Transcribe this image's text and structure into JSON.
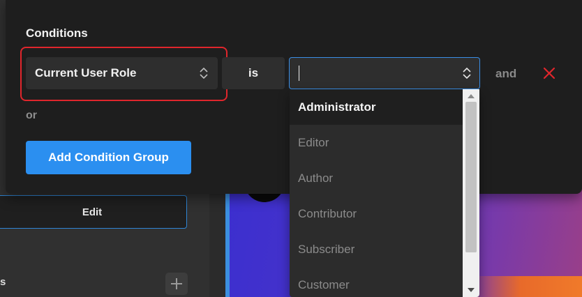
{
  "background": {
    "edit_button_label": "Edit",
    "section_label_fragment": "s",
    "add_icon": "plus-icon"
  },
  "conditions": {
    "title": "Conditions",
    "field_select": {
      "value": "Current User Role",
      "icon": "updown-chevron-icon"
    },
    "operator_select": {
      "value": "is"
    },
    "value_select": {
      "value": "",
      "icon": "updown-chevron-icon"
    },
    "and_label": "and",
    "remove_icon": "close-icon",
    "remove_color": "#e0262c",
    "or_label": "or",
    "add_group_label": "Add Condition Group",
    "accent_color": "#2b8ff0"
  },
  "dropdown": {
    "options": [
      "Administrator",
      "Editor",
      "Author",
      "Contributor",
      "Subscriber",
      "Customer"
    ],
    "active_index": 0,
    "scroll_up_icon": "arrow-up-icon",
    "scroll_down_icon": "arrow-down-icon"
  }
}
